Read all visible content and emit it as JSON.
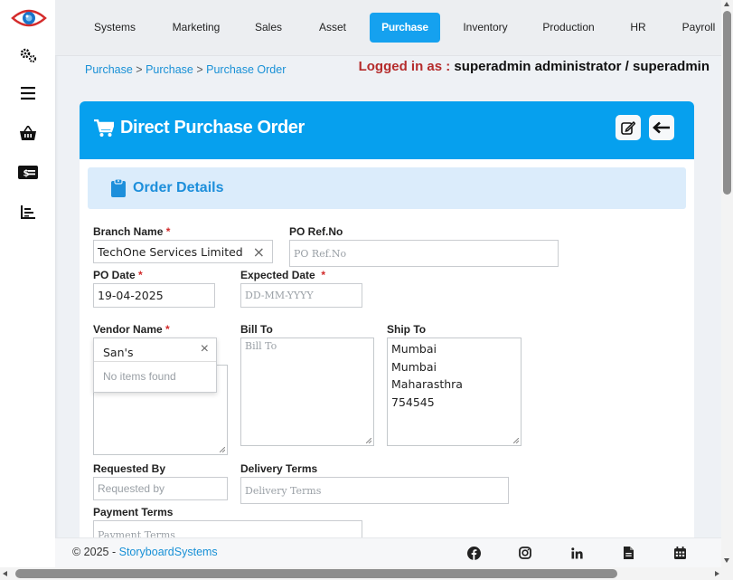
{
  "sidebar": {
    "icons": [
      "eye-logo-icon",
      "gears-icon",
      "menu-icon",
      "basket-icon",
      "money-bill-icon",
      "chart-icon"
    ]
  },
  "topnav": {
    "tabs": [
      "Systems",
      "Marketing",
      "Sales",
      "Asset",
      "Purchase",
      "Inventory",
      "Production",
      "HR",
      "Payroll"
    ],
    "active": "Purchase"
  },
  "breadcrumb": {
    "item1": "Purchase",
    "sep1": " > ",
    "item2": "Purchase",
    "sep2": " > ",
    "item3": "Purchase Order"
  },
  "login": {
    "label": "Logged in as :",
    "user": " superadmin administrator / superadmin"
  },
  "page": {
    "title": "Direct Purchase Order",
    "section": "Order Details"
  },
  "form": {
    "branch_name": {
      "label": "Branch Name",
      "value": "TechOne Services Limited",
      "clear": "×"
    },
    "po_ref": {
      "label": "PO Ref.No",
      "placeholder": "PO Ref.No"
    },
    "po_date": {
      "label": "PO Date",
      "value": "19-04-2025"
    },
    "expected_date": {
      "label": "Expected Date",
      "placeholder": "DD-MM-YYYY"
    },
    "vendor_name": {
      "label": "Vendor Name",
      "search": "San's",
      "clear": "×",
      "no_results": "No items found"
    },
    "bill_to": {
      "label": "Bill To",
      "placeholder": "Bill To"
    },
    "ship_to": {
      "label": "Ship To",
      "lines": [
        "Mumbai",
        "Mumbai",
        "Maharasthra",
        "754545"
      ]
    },
    "requested_by": {
      "label": "Requested By",
      "placeholder": "Requested by"
    },
    "delivery_terms": {
      "label": "Delivery Terms",
      "placeholder": "Delivery Terms"
    },
    "payment_terms": {
      "label": "Payment Terms",
      "placeholder": "Payment Terms"
    },
    "required_mark": "*"
  },
  "footer": {
    "copy": "© 2025 - ",
    "brand": "StoryboardSystems",
    "icons": [
      "facebook-icon",
      "instagram-icon",
      "linkedin-icon",
      "document-icon",
      "calendar-icon"
    ]
  },
  "colors": {
    "accent": "#06a0ee",
    "active_tab": "#15a1ef",
    "login_label": "#b52c2c",
    "link": "#1890d6"
  }
}
